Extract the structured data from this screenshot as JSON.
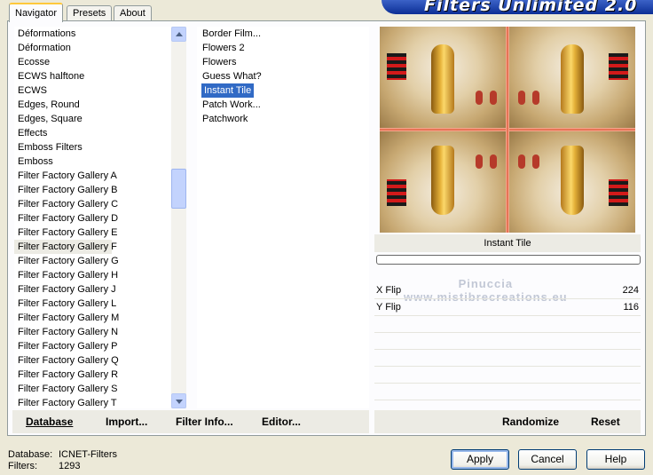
{
  "tabs": [
    "Navigator",
    "Presets",
    "About"
  ],
  "banner": "Filters Unlimited 2.0",
  "categories": [
    "Déformations",
    "Déformation",
    "Ecosse",
    "ECWS halftone",
    "ECWS",
    "Edges, Round",
    "Edges, Square",
    "Effects",
    "Emboss Filters",
    "Emboss",
    "Filter Factory Gallery A",
    "Filter Factory Gallery B",
    "Filter Factory Gallery C",
    "Filter Factory Gallery D",
    "Filter Factory Gallery E",
    "Filter Factory Gallery F",
    "Filter Factory Gallery G",
    "Filter Factory Gallery H",
    "Filter Factory Gallery J",
    "Filter Factory Gallery L",
    "Filter Factory Gallery M",
    "Filter Factory Gallery N",
    "Filter Factory Gallery P",
    "Filter Factory Gallery Q",
    "Filter Factory Gallery R",
    "Filter Factory Gallery S",
    "Filter Factory Gallery T"
  ],
  "selected_category": "Filter Factory Gallery F",
  "filters": [
    "Border Film...",
    "Flowers 2",
    "Flowers",
    "Guess What?",
    "Instant Tile",
    "Patch Work...",
    "Patchwork"
  ],
  "selected_filter": "Instant Tile",
  "preview_label": "Instant Tile",
  "watermark": {
    "line1": "Pinuccia",
    "line2": "www.mistibrecreations.eu"
  },
  "params": [
    {
      "label": "X Flip",
      "value": "224",
      "level": 224
    },
    {
      "label": "Y Flip",
      "value": "116",
      "level": 116
    }
  ],
  "toolbar": {
    "database": "Database",
    "import": "Import...",
    "filter_info": "Filter Info...",
    "editor": "Editor...",
    "randomize": "Randomize",
    "reset": "Reset"
  },
  "status": {
    "database_label": "Database:",
    "database_value": "ICNET-Filters",
    "filters_label": "Filters:",
    "filters_value": "1293"
  },
  "buttons": {
    "apply": "Apply",
    "cancel": "Cancel",
    "help": "Help"
  }
}
